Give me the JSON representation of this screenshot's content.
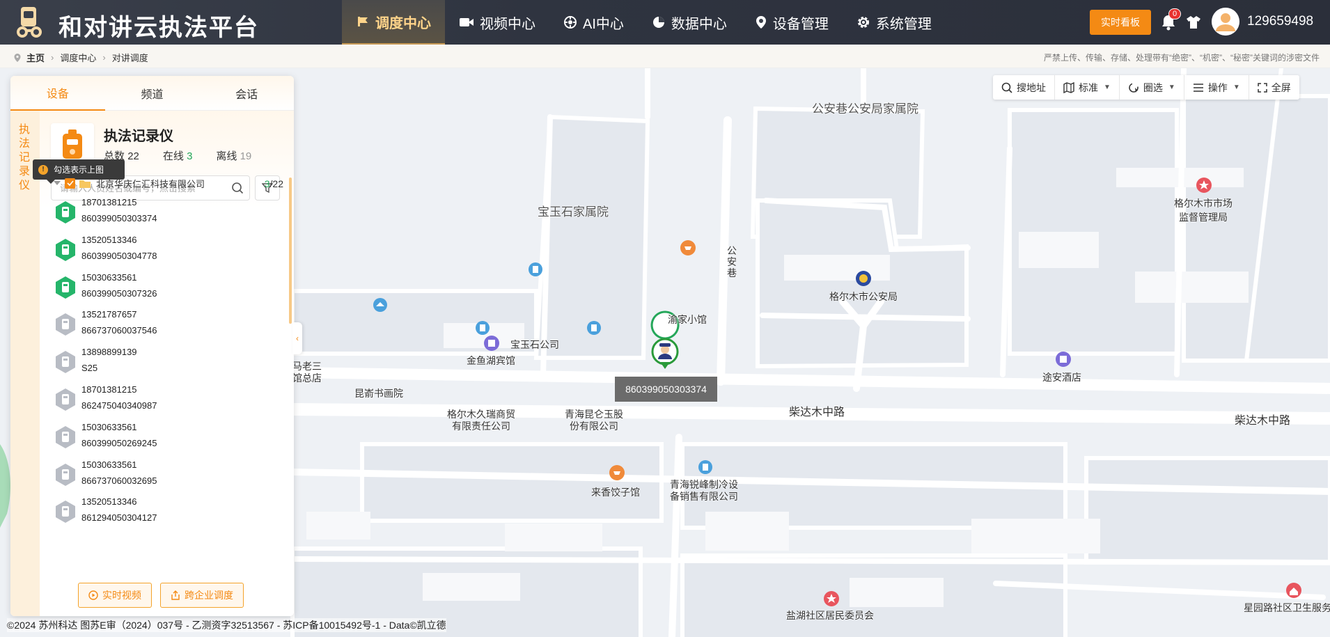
{
  "header": {
    "brand": "和对讲云执法平台",
    "nav": [
      {
        "label": "调度中心",
        "icon": "dispatch-icon",
        "active": true
      },
      {
        "label": "视频中心",
        "icon": "video-icon"
      },
      {
        "label": "AI中心",
        "icon": "ai-icon"
      },
      {
        "label": "数据中心",
        "icon": "pie-chart-icon"
      },
      {
        "label": "设备管理",
        "icon": "location-pin-icon"
      },
      {
        "label": "系统管理",
        "icon": "gear-icon"
      }
    ],
    "board_button": "实时看板",
    "notification_count": "0",
    "username": "129659498",
    "accent": "#f48a14"
  },
  "breadcrumb": {
    "home": "主页",
    "level1": "调度中心",
    "level2": "对讲调度",
    "notice": "严禁上传、传输、存储、处理带有“绝密”、“机密”、“秘密”关键词的涉密文件"
  },
  "map": {
    "tools": [
      {
        "label": "搜地址",
        "icon": "search-icon"
      },
      {
        "label": "标准",
        "icon": "map-layer-icon",
        "dropdown": true
      },
      {
        "label": "圈选",
        "icon": "lasso-icon",
        "dropdown": true
      },
      {
        "label": "操作",
        "icon": "menu-icon",
        "dropdown": true
      },
      {
        "label": "全屏",
        "icon": "fullscreen-icon"
      }
    ],
    "labels": {
      "gongan_xiang_family": "公安巷公安局家属院",
      "baoyushi_family": "宝玉石家属院",
      "market_bureau": "格尔木市市场\n监督管理局",
      "public_security": "格尔木市公安局",
      "gongan_xiang": "公\n安\n巷",
      "yujia": "渝家小馆",
      "baoyushi_company": "宝玉石公司",
      "jinyuhu": "金鱼湖宾馆",
      "malao": "马老三\n馆总店",
      "kunlun_art": "昆嵛书画院",
      "jiuruishang": "格尔木久瑞商贸\n有限责任公司",
      "kunlun_jade": "青海昆仑玉股\n份有限公司",
      "tuan_hotel": "途安酒店",
      "chaidamu_1": "柴达木中路",
      "chaidamu_2": "柴达木中路",
      "laixiang": "来香饺子馆",
      "ruifeng": "青海锐峰制冷设\n备销售有限公司",
      "yanhu": "盐湖社区居民委员会",
      "xingyuan": "星园路社区卫生服务"
    },
    "marker_tooltip": "860399050303374",
    "copyright": "©2024 苏州科达 图苏E审（2024）037号 - 乙测资字32513567 - 苏ICP备10015492号-1 - Data©凯立德"
  },
  "panel": {
    "tabs": [
      "设备",
      "频道",
      "会话"
    ],
    "side_label": "执法记录仪",
    "device_type": "执法记录仪",
    "stats": {
      "total_label": "总数",
      "total": "22",
      "online_label": "在线",
      "online": "3",
      "offline_label": "离线",
      "offline": "19"
    },
    "search_placeholder": "请输入人员姓名或编号，点击搜索",
    "tip": "勾选表示上图",
    "group": {
      "name": "北京华庆仁汇科技有限公司",
      "online": "3",
      "total": "/22"
    },
    "devices": [
      {
        "name": "18701381215",
        "id": "860399050303374",
        "online": true
      },
      {
        "name": "13520513346",
        "id": "860399050304778",
        "online": true
      },
      {
        "name": "15030633561",
        "id": "860399050307326",
        "online": true
      },
      {
        "name": "13521787657",
        "id": "866737060037546",
        "online": false
      },
      {
        "name": "13898899139",
        "id": "S25",
        "online": false
      },
      {
        "name": "18701381215",
        "id": "862475040340987",
        "online": false
      },
      {
        "name": "15030633561",
        "id": "860399050269245",
        "online": false
      },
      {
        "name": "15030633561",
        "id": "866737060032695",
        "online": false
      },
      {
        "name": "13520513346",
        "id": "861294050304127",
        "online": false
      }
    ],
    "btn_realtime": "实时视频",
    "btn_cross": "跨企业调度"
  }
}
